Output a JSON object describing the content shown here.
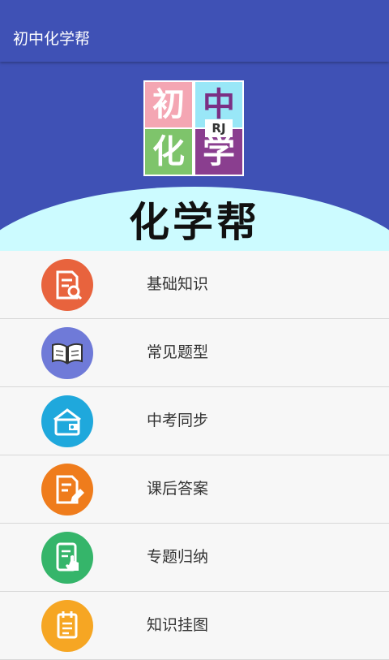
{
  "app": {
    "title": "初中化学帮"
  },
  "header": {
    "logo": {
      "chars": [
        "初",
        "中",
        "化",
        "学"
      ],
      "badge": "RJ"
    },
    "big_title": "化学帮"
  },
  "menu": [
    {
      "label": "基础知识",
      "icon": "search-document-icon",
      "color": "#e8633d"
    },
    {
      "label": "常见题型",
      "icon": "book-icon",
      "color": "#6f7ad8"
    },
    {
      "label": "中考同步",
      "icon": "house-wallet-icon",
      "color": "#1fa8dc"
    },
    {
      "label": "课后答案",
      "icon": "edit-document-icon",
      "color": "#ef7c1c"
    },
    {
      "label": "专题归纳",
      "icon": "tablet-touch-icon",
      "color": "#35b56a"
    },
    {
      "label": "知识挂图",
      "icon": "notepad-icon",
      "color": "#f6a623"
    }
  ],
  "colors": {
    "primary": "#3f51b5",
    "arc": "#ccfbff"
  }
}
